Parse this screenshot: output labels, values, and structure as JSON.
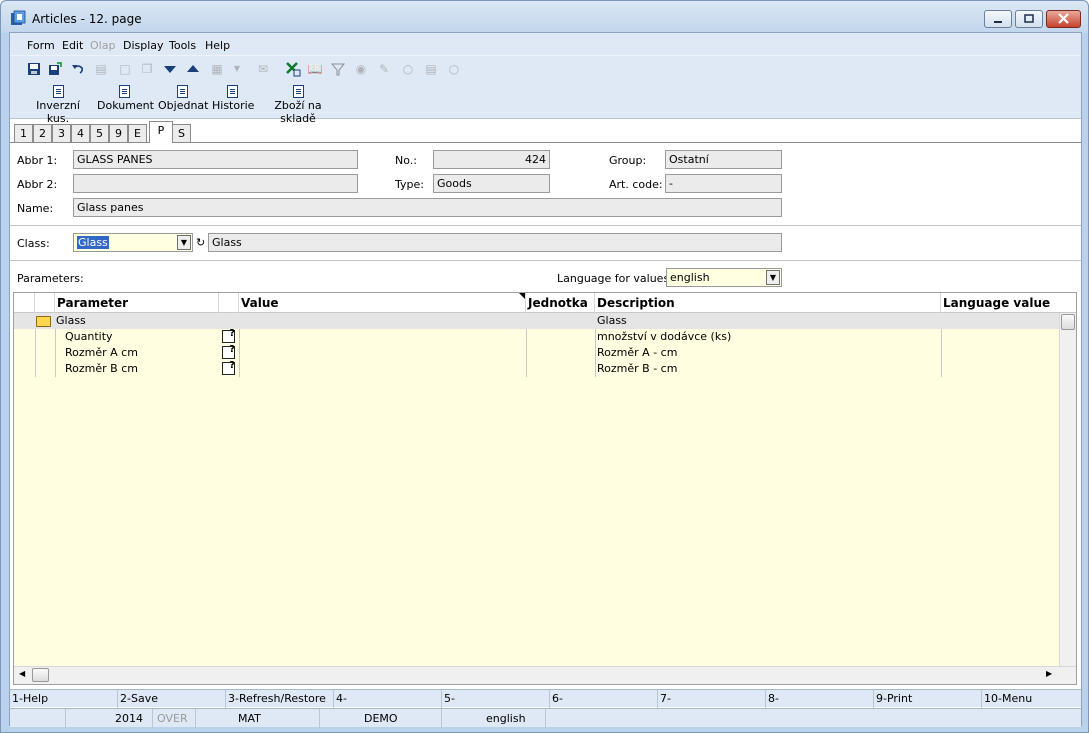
{
  "window": {
    "title": "Articles - 12. page"
  },
  "menu": [
    "Form",
    "Edit",
    "Olap",
    "Display",
    "Tools",
    "Help"
  ],
  "menu_disabled": [
    "Olap"
  ],
  "toolbar_icons": [
    "save-icon",
    "save-as-icon",
    "undo-icon",
    "open-icon",
    "new-icon",
    "copy-icon",
    "down-arrow-icon",
    "up-arrow-icon",
    "export-icon",
    "dropdown-icon",
    "mail-icon",
    "excel-icon",
    "book-icon",
    "filter-icon",
    "binoculars-icon",
    "edit-icon",
    "find-next-icon",
    "filter-list-icon",
    "find-prev-icon"
  ],
  "buttons": [
    "Inverzní kus.",
    "Dokument",
    "Objednat",
    "Historie",
    "Zboží na skladě"
  ],
  "tabs": [
    "1",
    "2",
    "3",
    "4",
    "5",
    "9",
    "E",
    "P",
    "S"
  ],
  "active_tab": "P",
  "form": {
    "abbr1_label": "Abbr 1:",
    "abbr1_value": "GLASS PANES",
    "abbr2_label": "Abbr 2:",
    "abbr2_value": "",
    "name_label": "Name:",
    "name_value": "Glass panes",
    "no_label": "No.:",
    "no_value": "424",
    "type_label": "Type:",
    "type_value": "Goods",
    "group_label": "Group:",
    "group_value": "Ostatní",
    "artcode_label": "Art. code:",
    "artcode_value": "-",
    "class_label": "Class:",
    "class_value": "Glass",
    "class_name": "Glass",
    "parameters_label": "Parameters:",
    "language_label": "Language for values:",
    "language_value": "english"
  },
  "grid": {
    "columns": [
      "Parameter",
      "Value",
      "Jednotka",
      "Description",
      "Language value"
    ],
    "rows": [
      {
        "parameter": "Glass",
        "value": "",
        "unit": "",
        "description": "Glass",
        "language_value": "",
        "group": true
      },
      {
        "parameter": "Quantity",
        "value": "",
        "unit": "",
        "description": "množství v dodávce (ks)",
        "language_value": "",
        "group": false
      },
      {
        "parameter": "Rozměr A cm",
        "value": "",
        "unit": "",
        "description": "Rozměr A - cm",
        "language_value": "",
        "group": false
      },
      {
        "parameter": "Rozměr B cm",
        "value": "",
        "unit": "",
        "description": "Rozměr B - cm",
        "language_value": "",
        "group": false
      }
    ]
  },
  "fkeys": [
    "1-Help",
    "2-Save",
    "3-Refresh/Restore",
    "4-",
    "5-",
    "6-",
    "7-",
    "8-",
    "9-Print",
    "10-Menu"
  ],
  "status": {
    "year": "2014",
    "over": "OVER",
    "user": "MAT",
    "db": "DEMO",
    "lang": "english"
  }
}
